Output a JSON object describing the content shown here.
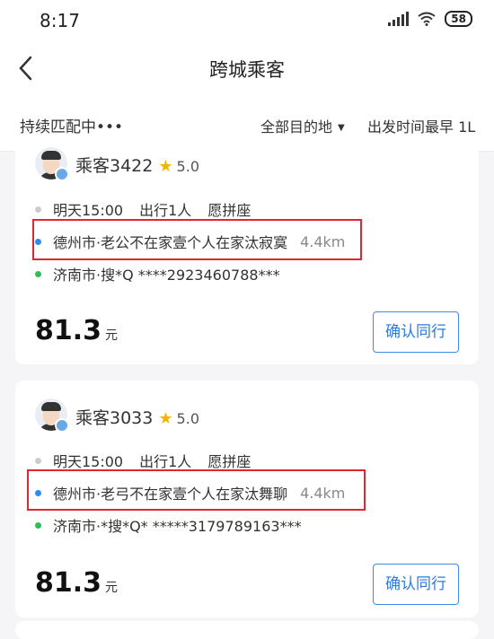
{
  "status_bar": {
    "time": "8:17",
    "battery": "58"
  },
  "nav": {
    "title": "跨城乘客"
  },
  "filters": {
    "matching": "持续匹配中•••",
    "destination": "全部目的地",
    "sort": "出发时间最早 1L"
  },
  "cards": [
    {
      "name": "乘客3422",
      "rating": "5.0",
      "trip_info": [
        "明天15:00",
        "出行1人",
        "愿拼座"
      ],
      "origin": "德州市·老公不在家壹个人在家汰寂寞",
      "origin_distance": "4.4km",
      "destination": "济南市·搜*Q ****2923460788***",
      "price": "81.3",
      "price_unit": "元",
      "button": "确认同行"
    },
    {
      "name": "乘客3033",
      "rating": "5.0",
      "trip_info": [
        "明天15:00",
        "出行1人",
        "愿拼座"
      ],
      "origin": "德州市·老弓不在家壹个人在家汰舞聊",
      "origin_distance": "4.4km",
      "destination": "济南市·*搜*Q* *****3179789163***",
      "price": "81.3",
      "price_unit": "元",
      "button": "确认同行"
    }
  ],
  "colors": {
    "accent": "#2d7be0",
    "highlight_box": "#e0262f",
    "origin_dot": "#2d8cf0",
    "destination_dot": "#2ebd59",
    "star": "#f5b400"
  },
  "icons": [
    "back-arrow-icon",
    "signal-icon",
    "wifi-icon",
    "battery-icon",
    "star-icon",
    "verified-icon"
  ]
}
